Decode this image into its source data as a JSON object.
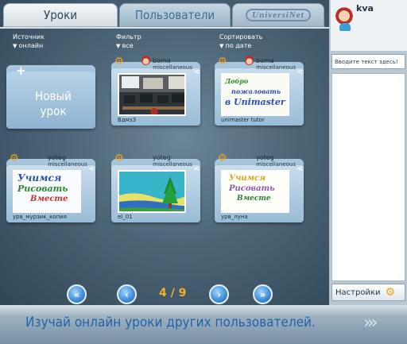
{
  "tabs": {
    "lessons": "Уроки",
    "users": "Пользователи",
    "logo": "UniversiNet"
  },
  "filters": [
    {
      "label": "Источник",
      "value": "онлайн"
    },
    {
      "label": "Фильтр",
      "value": "все"
    },
    {
      "label": "Сортировать",
      "value": "по дате"
    }
  ],
  "new_lesson": {
    "line1": "Новый",
    "line2": "урок"
  },
  "cards": [
    {
      "author": "boma",
      "category": "miscellaneous",
      "title": "Вдмз3",
      "thumb_text": ""
    },
    {
      "author": "boma",
      "category": "miscellaneous",
      "title": "unimaster tutor",
      "thumb_text": [
        "Добро",
        "пожаловать",
        "в Unimaster"
      ]
    },
    {
      "author": "yoteg",
      "category": "miscellaneous",
      "title": "урв_мурзик_копия",
      "thumb_text": [
        "Учимся",
        "Рисовать",
        "Вместе"
      ]
    },
    {
      "author": "yoteg",
      "category": "miscellaneous",
      "title": "el_01",
      "thumb_text": ""
    },
    {
      "author": "yoteg",
      "category": "miscellaneous",
      "title": "урв_луна",
      "thumb_text": [
        "Учимся",
        "Рисовать",
        "Вместе"
      ]
    }
  ],
  "pager": {
    "first": "«",
    "prev": "‹",
    "page": "4 / 9",
    "next": "›",
    "last": "»"
  },
  "banner": "Изучай онлайн уроки других пользователей.",
  "banner_arrows": "›››",
  "user": {
    "name": "kva"
  },
  "chat": {
    "placeholder": "Вводите текст здесь!"
  },
  "settings": "Настройки",
  "icons": {
    "gear": "gear-icon",
    "share": "share-icon",
    "avatar": "avatar-icon"
  },
  "colors": {
    "accent": "#f3b02b",
    "link": "#1e63ad",
    "pager": "#2f7fcf"
  }
}
